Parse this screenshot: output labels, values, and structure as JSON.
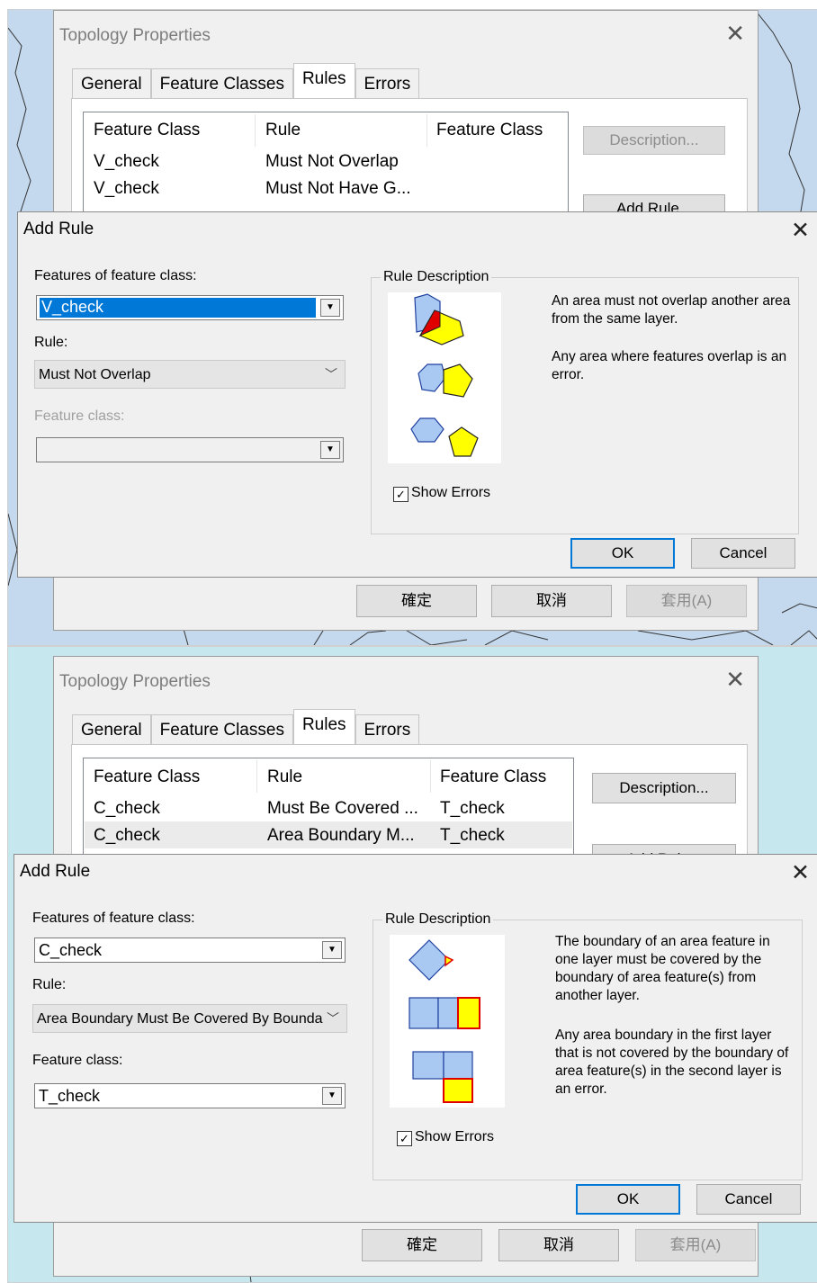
{
  "panels": [
    {
      "topology": {
        "title": "Topology Properties",
        "close": "✕",
        "tabs": [
          "General",
          "Feature Classes",
          "Rules",
          "Errors"
        ],
        "list_headers": [
          "Feature Class",
          "Rule",
          "Feature Class"
        ],
        "rows": [
          {
            "fc1": "V_check",
            "rule": "Must Not Overlap",
            "fc2": ""
          },
          {
            "fc1": "V_check",
            "rule": "Must Not Have G...",
            "fc2": ""
          }
        ],
        "description_button": "Description...",
        "add_rule_button": "Add Rule...",
        "footer": {
          "ok": "確定",
          "cancel": "取消",
          "apply": "套用(A)"
        }
      },
      "add_rule": {
        "title": "Add Rule",
        "close": "✕",
        "features_label": "Features of feature class:",
        "features_value": "V_check",
        "rule_label": "Rule:",
        "rule_value": "Must Not Overlap",
        "feature_class_label": "Feature class:",
        "feature_class_value": "",
        "group_title": "Rule Description",
        "description_1": "An area must not overlap another area from the same layer.",
        "description_2": "Any area where features overlap is an error.",
        "show_errors_label": "Show Errors",
        "show_errors_checked": true,
        "ok": "OK",
        "cancel": "Cancel"
      }
    },
    {
      "topology": {
        "title": "Topology Properties",
        "close": "✕",
        "tabs": [
          "General",
          "Feature Classes",
          "Rules",
          "Errors"
        ],
        "list_headers": [
          "Feature Class",
          "Rule",
          "Feature Class"
        ],
        "rows": [
          {
            "fc1": "C_check",
            "rule": "Must Be Covered ...",
            "fc2": "T_check"
          },
          {
            "fc1": "C_check",
            "rule": "Area Boundary M...",
            "fc2": "T_check"
          }
        ],
        "description_button": "Description...",
        "add_rule_button": "Add Rule...",
        "footer": {
          "ok": "確定",
          "cancel": "取消",
          "apply": "套用(A)"
        }
      },
      "add_rule": {
        "title": "Add Rule",
        "close": "✕",
        "features_label": "Features of feature class:",
        "features_value": "C_check",
        "rule_label": "Rule:",
        "rule_value": "Area Boundary Must Be Covered By Boundary Of",
        "feature_class_label": "Feature class:",
        "feature_class_value": "T_check",
        "group_title": "Rule Description",
        "description_1": "The boundary of an area feature in one layer must be covered by the boundary of area feature(s) from another layer.",
        "description_2": "Any area boundary in the first layer that is not covered by the boundary of area feature(s) in the second layer is an error.",
        "show_errors_label": "Show Errors",
        "show_errors_checked": true,
        "ok": "OK",
        "cancel": "Cancel"
      }
    }
  ],
  "colors": {
    "map_bg_1": "#c5d9ee",
    "map_bg_2": "#c7e7ef",
    "selection": "#0078d7",
    "shape_blue": "#a9c9f2",
    "shape_yellow": "#ffff00",
    "error_red": "#e00000"
  }
}
